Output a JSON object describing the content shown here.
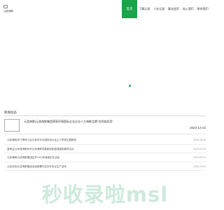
{
  "brand": {
    "name": "元游海鲜"
  },
  "nav": {
    "active": "首页",
    "items": [
      "了解元游",
      "人在元游",
      "事长追声",
      "加入我们",
      "联系我们"
    ]
  },
  "news": {
    "section_title": "新闻动态",
    "feature": {
      "title": "元游海鲜|元游海鲜集团荣获环境国际企业企业十大海鲜品牌\"优秀组织奖\"",
      "date": "2023-12-22"
    },
    "items": [
      {
        "title": "元游海鲜|学习贯彻习近平新时代中国特色社会主义思想主题教育",
        "date": "2023-05-26"
      },
      {
        "title": "重磅|企业年度海鲜系列元游海鲜发展新起航暨强盛新篇章活动",
        "date": "2023-04-05"
      },
      {
        "title": "元游海鲜|元游海鲜集团召开2022年度组织生活会",
        "date": "2023-03-24"
      },
      {
        "title": "元游动态|元游海鲜集团全面部署开启全年安全生产活动",
        "date": "2023-03-03"
      }
    ]
  },
  "watermark": "秒收录啦msl",
  "colors": {
    "accent": "#1ba34a"
  }
}
